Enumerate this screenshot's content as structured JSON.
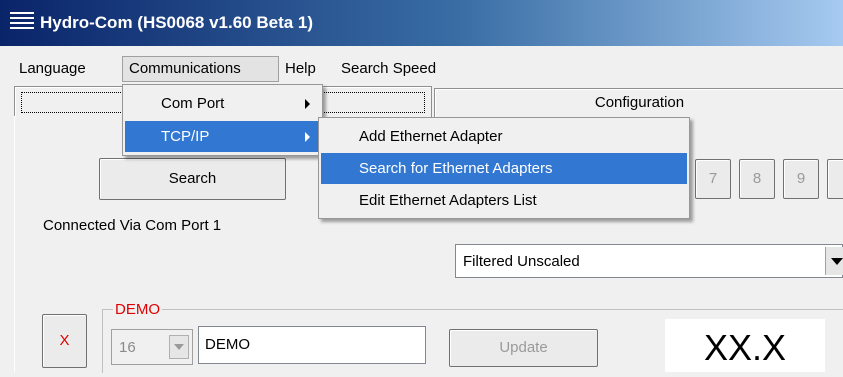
{
  "window": {
    "title": "Hydro-Com (HS0068 v1.60 Beta 1)",
    "app_icon": "hamburger-lines-icon"
  },
  "menubar": {
    "items": [
      "Language",
      "Communications",
      "Help",
      "Search Speed"
    ]
  },
  "tabs": {
    "active_label": "",
    "configuration": "Configuration"
  },
  "main": {
    "search_button": "Search",
    "address_buttons": [
      "7",
      "8",
      "9"
    ],
    "connection_status": "Connected Via Com Port 1",
    "output_mode": "Filtered Unscaled"
  },
  "sensor": {
    "group_label": "DEMO",
    "remove_button": "X",
    "address": "16",
    "name": "DEMO",
    "update_button": "Update",
    "reading": "XX.X"
  },
  "communications_menu": {
    "items": [
      "Com Port",
      "TCP/IP"
    ]
  },
  "tcpip_submenu": {
    "items": [
      "Add Ethernet Adapter",
      "Search for Ethernet Adapters",
      "Edit Ethernet Adapters List"
    ]
  },
  "colors": {
    "title_gradient_start": "#0a246a",
    "menu_highlight": "#3278d2",
    "accent_red": "#e00000"
  }
}
